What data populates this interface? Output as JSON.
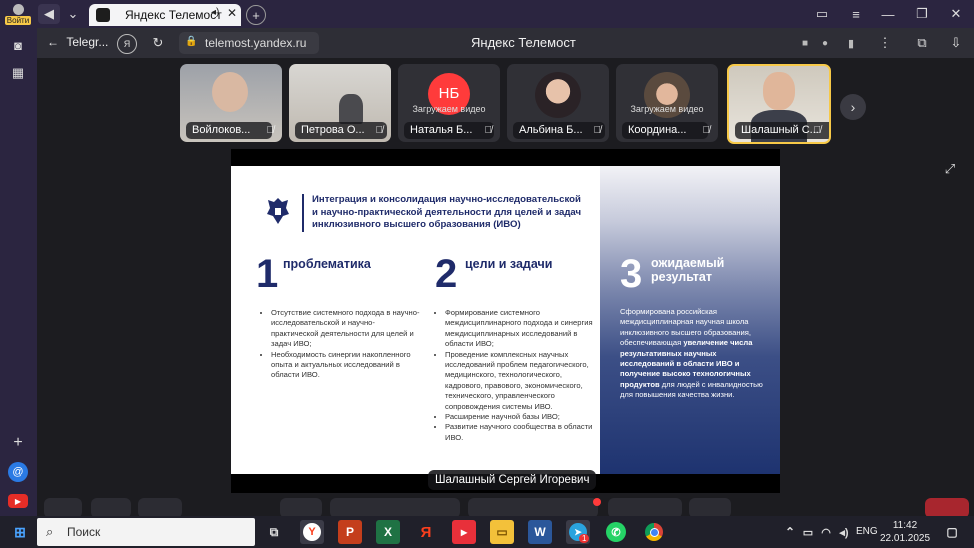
{
  "browser": {
    "profile_label": "Войти",
    "active_tab_title": "Яндекс Телемост",
    "back_label": "Telegr...",
    "url": "telemost.yandex.ru",
    "page_title": "Яндекс Телемост"
  },
  "participants": [
    {
      "name": "Войлоков...",
      "loading": "",
      "initials": ""
    },
    {
      "name": "Петрова О...",
      "loading": "",
      "initials": ""
    },
    {
      "name": "Наталья Б...",
      "loading": "Загружаем видео",
      "initials": "НБ"
    },
    {
      "name": "Альбина Б...",
      "loading": "",
      "initials": ""
    },
    {
      "name": "Координа...",
      "loading": "Загружаем видео",
      "initials": ""
    },
    {
      "name": "Шалашный С...",
      "loading": "",
      "initials": ""
    }
  ],
  "slide": {
    "title": "Интеграция и консолидация научно-исследовательской и научно-практической деятельности для целей и задач инклюзивного высшего образования (ИВО)",
    "col1": {
      "num": "1",
      "heading": "проблематика",
      "bullets": [
        "Отсутствие системного подхода в научно-исследовательской и научно-практической деятельности для целей и задач ИВО;",
        "Необходимость синергии накопленного опыта и актуальных исследований в области ИВО."
      ]
    },
    "col2": {
      "num": "2",
      "heading": "цели и задачи",
      "bullets": [
        "Формирование системного междисциплинарного подхода и синергия междисциплинарных исследований в области ИВО;",
        "Проведение комплексных научных исследований проблем педагогического, медицинского, технологического, кадрового, правового, экономического, технического, управленческого сопровождения системы ИВО.",
        "Расширение научной базы ИВО;",
        "Развитие научного сообщества в области ИВО."
      ]
    },
    "col3": {
      "num": "3",
      "heading_line1": "ожидаемый",
      "heading_line2": "результат",
      "text_1": "Сформирована российская междисциплинарная научная школа инклюзивного высшего образования, обеспечивающая ",
      "text_bold": "увеличение числа результативных научных исследований в области ИВО и получение высоко технологичных продуктов",
      "text_2": " для людей с инвалидностью для повышения качества жизни."
    }
  },
  "speaker_name": "Шалашный Сергей Игоревич",
  "taskbar": {
    "search_placeholder": "Поиск",
    "language": "ENG",
    "time": "11:42",
    "date": "22.01.2025",
    "telegram_badge": "1"
  },
  "colors": {
    "accent": "#f7c948",
    "slide_blue": "#1f2b6a",
    "yandex_red": "#fc3f1d"
  }
}
